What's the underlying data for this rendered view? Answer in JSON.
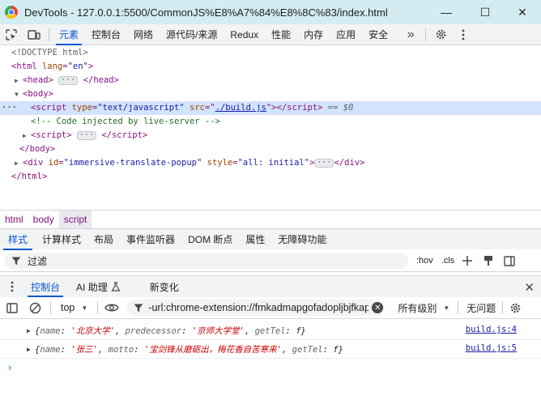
{
  "window": {
    "title": "DevTools - 127.0.0.1:5500/CommonJS%E8%A7%84%E8%8C%83/index.html",
    "minimize": "—",
    "maximize": "☐",
    "close": "✕"
  },
  "toolbar": {
    "inspect_icon": "inspect-element-icon",
    "device_icon": "device-toggle-icon",
    "tabs": [
      "元素",
      "控制台",
      "网络",
      "源代码/来源",
      "Redux",
      "性能",
      "内存",
      "应用",
      "安全"
    ],
    "active_tab": "元素",
    "more": "»"
  },
  "elements": {
    "doctype": "<!DOCTYPE html>",
    "html_open_tag": "html",
    "html_attr_name": "lang",
    "html_attr_value": "\"en\"",
    "head": "head",
    "body": "body",
    "script_tag": "script",
    "script_type_attr": "type",
    "script_type_value": "\"text/javascript\"",
    "script_src_attr": "src",
    "script_src_value": "./build.js",
    "selected_marker": "== $0",
    "dots": "···",
    "comment": "<!-- Code injected by live-server -->",
    "div_tag": "div",
    "div_id_attr": "id",
    "div_id_value": "\"immersive-translate-popup\"",
    "div_style_attr": "style",
    "div_style_value": "\"all: initial\"",
    "ellipsis": "···"
  },
  "breadcrumbs": [
    "html",
    "body",
    "script"
  ],
  "styles_tabs": [
    "样式",
    "计算样式",
    "布局",
    "事件监听器",
    "DOM 断点",
    "属性",
    "无障碍功能"
  ],
  "styles_filter": {
    "placeholder": "过滤",
    "hov": ":hov",
    "cls": ".cls"
  },
  "drawer": {
    "tabs": [
      "控制台",
      "AI 助理",
      "新变化"
    ],
    "active_tab": "控制台"
  },
  "console_toolbar": {
    "context": "top",
    "filter_value": "-url:chrome-extension://fmkadmapgofadopljbjfkapdkoienihi",
    "levels": "所有级别",
    "issues": "无问题"
  },
  "console_messages": [
    {
      "name_key": "name",
      "name_val": "'北京大学'",
      "k2": "predecessor",
      "v2": "'京师大学堂'",
      "k3": "getTel",
      "v3": "f",
      "source": "build.js:4"
    },
    {
      "name_key": "name",
      "name_val": "'张三'",
      "k2": "motto",
      "v2": "'宝剑锋从磨砺出，梅花香自苦寒来'",
      "k3": "getTel",
      "v3": "f",
      "source": "build.js:5"
    }
  ],
  "prompt": "›"
}
